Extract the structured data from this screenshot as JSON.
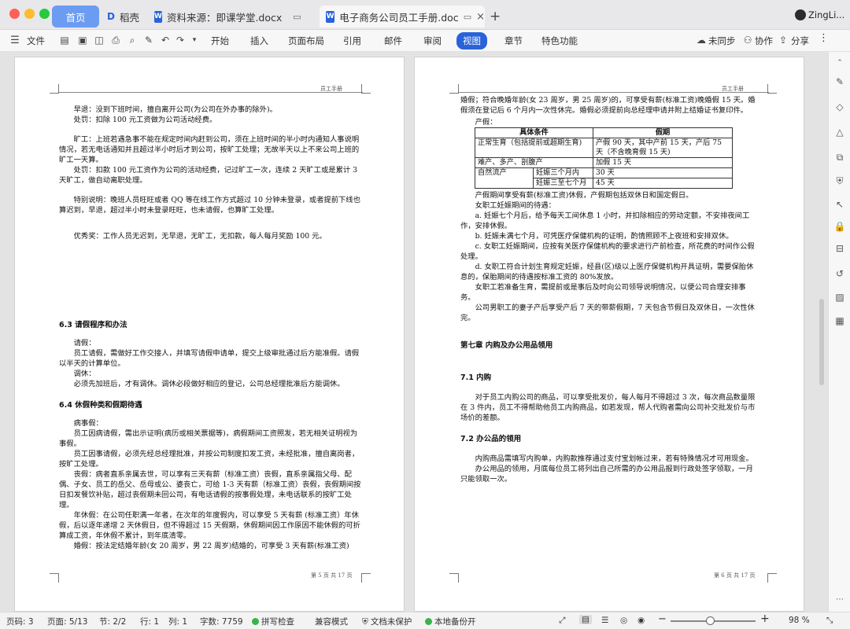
{
  "tabs": [
    {
      "label": "首页"
    },
    {
      "label": "稻壳"
    },
    {
      "label": "资料来源：即课学堂.docx"
    },
    {
      "label": "电子商务公司员工手册.doc"
    }
  ],
  "user": {
    "name": "ZingLi..."
  },
  "menu": {
    "file": "文件",
    "items": [
      "开始",
      "插入",
      "页面布局",
      "引用",
      "邮件",
      "审阅",
      "视图",
      "章节",
      "特色功能"
    ],
    "active_index": 6,
    "sync": "未同步",
    "collab": "协作",
    "share": "分享"
  },
  "left_page": {
    "header": "员工手册",
    "lines": [
      "早退：没到下班时间，擅自离开公司(为公司在外办事的除外)。",
      "处罚：扣除 100 元工资做为公司活动经费。",
      "旷工：上班若遇急事不能在规定时间内赶到公司，须在上班时间的半小时内通知人事说明情况，若无电话通知并且超过半小时后才到公司，按旷工处理；无故半天以上不来公司上班的旷工一天算。",
      "处罚：扣款 100 元工资作为公司的活动经费，记过旷工一次，连续 2 天旷工或是累计 3 天旷工，做自动离职处理。",
      "特别说明：晚班人员旺旺或者 QQ 等在线工作方式超过 10 分钟未登录，或者提前下线也算迟到，早退，超过半小时未登录旺旺，也未请假，也算旷工处理。",
      "优秀奖：工作人员无迟到，无早退，无旷工，无扣款，每人每月奖励 100 元。"
    ],
    "section1": "6.3 请假程序和办法",
    "s1_lines": [
      "请假：",
      "员工请假，需做好工作交接人，并填写请假申请单，提交上级审批通过后方能准假。请假以半天的计算单位。",
      "调休：",
      "必须先加班后，才有调休。调休必段做好相应的登记，公司总经理批准后方能调休。"
    ],
    "section2": "6.4 休假种类和假期待遇",
    "s2_lines": [
      "病事假：",
      "员工因病请假，需出示证明(病历或相关票据等)，病假期间工资照发，若无相关证明视为事假。",
      "员工因事请假，必须先经总经理批准，并按公司制度扣发工资，未经批准，擅自离岗者，按旷工处理。",
      "丧假：病者直系亲属去世，可以享有三天有薪（标准工资）丧假，直系亲属指父母、配偶、子女、员工的岳父、岳母或公、婆丧亡，可给 1-3 天有薪（标准工资）丧假，丧假期间按日扣发餐饮补贴，超过丧假期未回公司，有电话请假的按事假处理，未电话联系的按旷工处理。",
      "年休假：在公司任职满一年者，在次年的年度假内，可以享受 5 天有薪 (标准工资）年休假，后以逐年递增 2 天休假日，但不得超过 15 天假期，休假期间因工作原因不能休假的可折算成工资，年休假不累计，到年底清零。",
      "婚假：按法定结婚年龄(女 20 周岁，男 22 周岁)结婚的，可享受 3 天有薪(标准工资)"
    ],
    "footer": "第 5 页 共 17 页"
  },
  "right_page": {
    "header": "员工手册",
    "intro": "婚假；符合晚婚年龄(女 23 周岁，男 25 周岁)的，可享受有薪(标准工资)晚婚假 15 天。婚假须在登记后 6 个月内一次性休完。婚假必须提前向总经理申请并附上结婚证书复印件。",
    "maternity": "产假：",
    "table": {
      "head": [
        "具体条件",
        "假期"
      ],
      "rows": [
        [
          "正常生育（包括提前或超期生育)",
          "",
          "产假 90 天，其中产前 15 天，产后 75 天（不含晚育假 15 天)"
        ],
        [
          "难产、多产、剖腹产",
          "",
          "加假 15 天"
        ],
        [
          "自然流产",
          "妊娠三个月内",
          "30 天"
        ],
        [
          "",
          "妊娠三至七个月",
          "45 天"
        ]
      ]
    },
    "lines": [
      "产假期间享受有薪(标准工资)休假，产假期包括双休日和国定假日。",
      "女职工妊娠期间的待遇：",
      "a. 妊娠七个月后，给予每天工间休息 1 小时，并扣除相应的劳动定额，不安排夜间工作，安排休假。",
      "b. 妊娠未满七个月，可凭医疗保健机构的证明，酌情照顾不上夜班和安排双休。",
      "c. 女职工妊娠期间，应按有关医疗保健机构的要求进行产前检查，所花费的时间作公假处理。",
      "d. 女职工符合计划生育规定妊娠，经县(区)级以上医疗保健机构开具证明，需要保胎休息的，保胎期间的待遇按标准工资的 80%发放。",
      "女职工若准备生育，需提前或是事后及时向公司领导说明情况，以便公司合理安排事务。",
      "公司男职工的妻子产后享受产后 7 天的带薪假期，7 天包含节假日及双休日，一次性休完。"
    ],
    "chapter": "第七章 内购及办公用品领用",
    "sec71": "7.1 内购",
    "sec71_text": "对于员工内购公司的商品，可以享受批发价，每人每月不得超过 3 次，每次商品数量限在 3 件内，员工不得帮助他员工内购商品，如若发现，帮人代购者需向公司补交批发价与市场价的差额。",
    "sec72": "7.2 办公品的领用",
    "sec72_lines": [
      "内购商品需填写内购单，内购款推荐通过支付宝划帐过来，若有特殊情况才可用现金。",
      "办公用品的领用，月底每位员工将列出自己所需的办公用品报到行政处签字领取，一月只能领取一次。"
    ],
    "footer": "第 6 页 共 17 页"
  },
  "status": {
    "row": "页码: 3",
    "page": "页面: 5/13",
    "section": "节: 2/2",
    "line": "行: 1",
    "col": "列: 1",
    "words": "字数: 7759",
    "spell": "拼写检查",
    "compat": "兼容模式",
    "protect": "文档未保护",
    "backup": "本地备份开",
    "zoom": "98 %"
  },
  "zoom_level": 0.98,
  "colors": {
    "accent": "#2a62d9",
    "active_menu_bg": "#2a62d9",
    "ok_green": "#3bb24a"
  }
}
